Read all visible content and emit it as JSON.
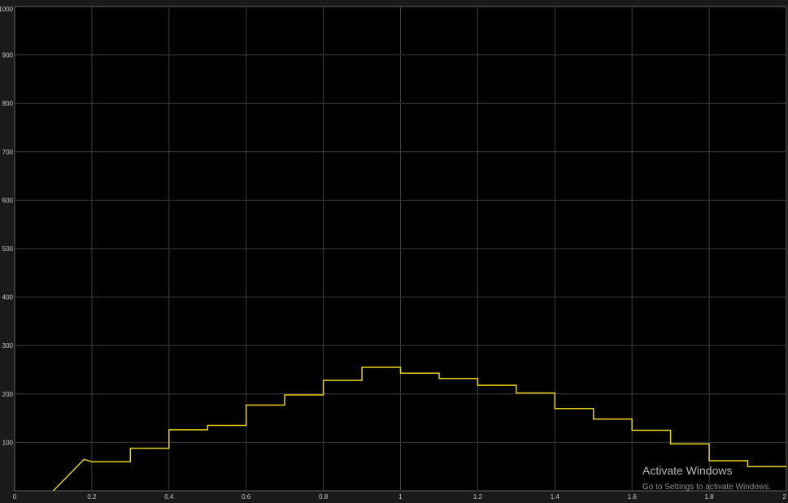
{
  "chart_data": {
    "type": "line",
    "title": "",
    "xlabel": "",
    "ylabel": "",
    "xlim": [
      0,
      2
    ],
    "ylim": [
      0,
      1000
    ],
    "x_ticks": [
      0,
      0.2,
      0.4,
      0.6,
      0.8,
      1,
      1.2,
      1.4,
      1.6,
      1.8,
      2
    ],
    "x_tick_labels": [
      "0",
      "0.2",
      "0.4",
      "0.6",
      "0.8",
      "1",
      "1.2",
      "1.4",
      "1.6",
      "1.8",
      "2"
    ],
    "y_ticks": [
      100,
      200,
      300,
      400,
      500,
      600,
      700,
      800,
      900,
      1000
    ],
    "y_tick_labels": [
      "100",
      "200",
      "300",
      "400",
      "500",
      "600",
      "700",
      "800",
      "900",
      "1000"
    ],
    "grid": true,
    "background": "#000000",
    "series": [
      {
        "color": "#e6d21a",
        "x": [
          0.1,
          0.18,
          0.2,
          0.3,
          0.3,
          0.4,
          0.4,
          0.5,
          0.5,
          0.6,
          0.6,
          0.7,
          0.7,
          0.8,
          0.8,
          0.9,
          0.9,
          1.0,
          1.0,
          1.1,
          1.1,
          1.2,
          1.2,
          1.3,
          1.3,
          1.4,
          1.4,
          1.5,
          1.5,
          1.6,
          1.6,
          1.7,
          1.7,
          1.8,
          1.8,
          1.9,
          1.9,
          2.0
        ],
        "y": [
          0,
          65,
          60,
          60,
          88,
          88,
          126,
          126,
          135,
          135,
          177,
          177,
          198,
          198,
          228,
          228,
          255,
          255,
          243,
          243,
          232,
          232,
          218,
          218,
          202,
          202,
          170,
          170,
          148,
          148,
          125,
          125,
          97,
          97,
          62,
          62,
          50,
          50
        ]
      }
    ]
  },
  "watermark": {
    "title": "Activate Windows",
    "subtitle": "Go to Settings to activate Windows."
  }
}
